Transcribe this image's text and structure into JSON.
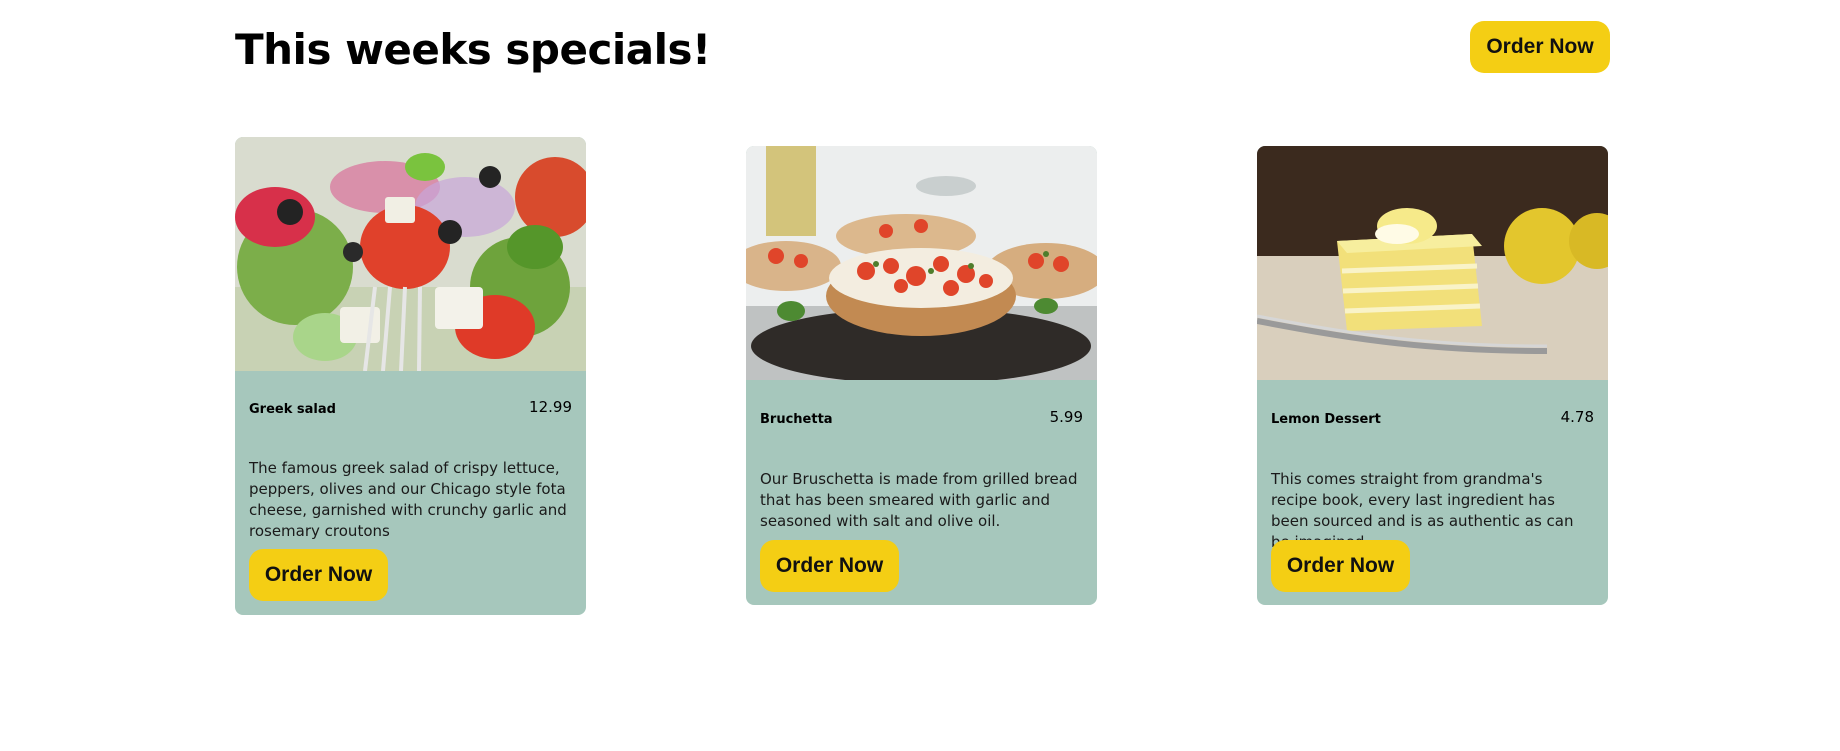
{
  "page": {
    "title": "This weeks specials!",
    "order_button_label": "Order Now"
  },
  "colors": {
    "accent": "#f4ce14",
    "card_background": "#a6c7bc"
  },
  "specials": [
    {
      "name": "Greek salad",
      "price": "12.99",
      "description": "The famous greek salad of crispy lettuce, peppers, olives and our Chicago style fota cheese, garnished with crunchy garlic and rosemary croutons",
      "button_label": "Order Now",
      "image": "greek-salad-photo"
    },
    {
      "name": "Bruchetta",
      "price": "5.99",
      "description": "Our Bruschetta is made from grilled bread that has been smeared with garlic and seasoned with salt and olive oil.",
      "button_label": "Order Now",
      "image": "bruschetta-photo"
    },
    {
      "name": "Lemon Dessert",
      "price": "4.78",
      "description": "This comes straight from grandma's recipe book, every last ingredient has been sourced and is as authentic as can be imagined.",
      "button_label": "Order Now",
      "image": "lemon-dessert-photo"
    }
  ]
}
